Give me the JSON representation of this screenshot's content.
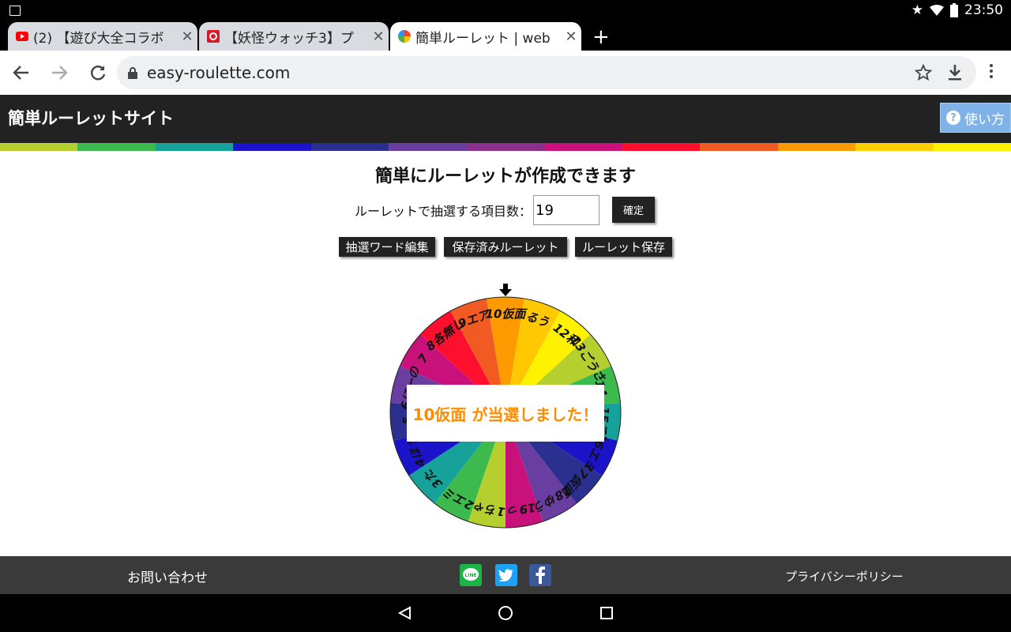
{
  "status": {
    "time": "23:50"
  },
  "tabs": [
    {
      "title": "(2) 【遊び大全コラボ",
      "color": "#ff0000"
    },
    {
      "title": "【妖怪ウォッチ3】プ",
      "color": "#d81b2a"
    },
    {
      "title": "簡単ルーレット | web",
      "color": "#4caf50"
    }
  ],
  "browser": {
    "url": "easy-roulette.com"
  },
  "site": {
    "title": "簡単ルーレットサイト",
    "howto_label": "使い方"
  },
  "main": {
    "heading": "簡単にルーレットが作成できます",
    "count_label": "ルーレットで抽選する項目数：",
    "count_value": "19",
    "confirm_label": "確定",
    "edit_label": "抽選ワード編集",
    "saved_label": "保存済みルーレット",
    "save_label": "ルーレット保存"
  },
  "wheel": {
    "items": [
      "10仮面",
      "るう",
      "12和",
      "13ごうさ",
      "14",
      "15ニ",
      "16エミ",
      "17仮面",
      "18ゆう",
      "19っ",
      "1ちゃ",
      "2エミ",
      "3た",
      "4ほぅ",
      "5",
      "6ほーの",
      "7",
      "8各無し",
      "9エア"
    ],
    "result_text": "10仮面 が当選しました！"
  },
  "footer": {
    "contact": "お問い合わせ",
    "privacy": "プライバシーポリシー",
    "line": "LINE"
  },
  "colors": {
    "rainbow": [
      "#b5cf2e",
      "#3dba4e",
      "#16a29a",
      "#1b13c9",
      "#2b2f8f",
      "#6a3ea1",
      "#8a2f8c",
      "#c8117a",
      "#ff0f2e",
      "#f15a22",
      "#ff9a00",
      "#ffd000",
      "#fff200"
    ],
    "wheel": [
      "#ff9a00",
      "#ffc800",
      "#fff200",
      "#b5cf2e",
      "#3dba4e",
      "#16a29a",
      "#1b13c9",
      "#2b2f8f",
      "#6a3ea1",
      "#c8117a",
      "#b5cf2e",
      "#3dba4e",
      "#16a29a",
      "#1b13c9",
      "#2b2f8f",
      "#6a3ea1",
      "#c8117a",
      "#ff0f2e",
      "#f15a22"
    ]
  }
}
